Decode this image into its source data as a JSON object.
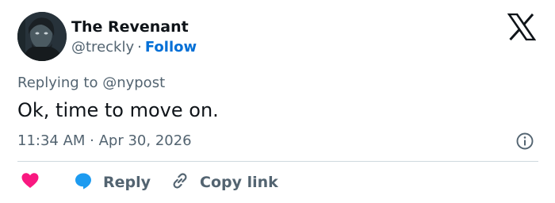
{
  "tweet": {
    "author_name": "The Revenant",
    "handle": "@treckly",
    "separator": "·",
    "follow_label": "Follow",
    "replying_to": "Replying to @nypost",
    "text": "Ok, time to move on.",
    "timestamp": "11:34 AM · Apr 30, 2026"
  },
  "actions": {
    "like_icon": "heart-icon",
    "reply_label": "Reply",
    "copy_link_label": "Copy link"
  },
  "colors": {
    "follow": "#006fd6",
    "like": "#f91880",
    "reply_bubble": "#1d9bf0",
    "muted_text": "#536471",
    "text": "#0f1419",
    "divider": "#cfd9de"
  },
  "icons": [
    "avatar",
    "x-logo-icon",
    "info-icon",
    "heart-icon",
    "reply-bubble-icon",
    "link-icon"
  ]
}
